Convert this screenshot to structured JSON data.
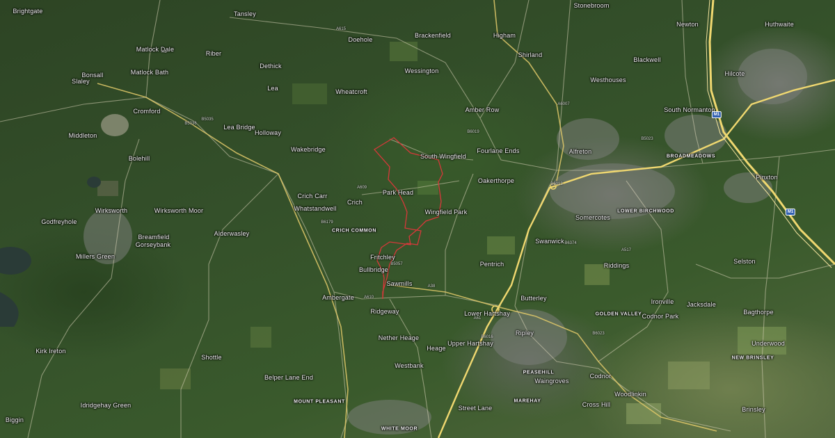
{
  "map": {
    "boundary_color": "#d8383a",
    "motorway_color": "#f0d870",
    "road_color": "#d9d3b8",
    "motorway_shield": "M1",
    "places": [
      "Brightgate",
      "Tansley",
      "Stonebroom",
      "Matlock Dale",
      "Doehole",
      "Brackenfield",
      "Higham",
      "Newton",
      "Huthwaite",
      "Bonsall",
      "Matlock Bath",
      "Riber",
      "Shirland",
      "Blackwell",
      "Dethick",
      "Wessington",
      "Hilcote",
      "Slaley",
      "Westhouses",
      "Lea",
      "Wheatcroft",
      "Cromford",
      "South Normanton",
      "Amber Row",
      "Middleton",
      "Lea Bridge",
      "Holloway",
      "Alfreton",
      "Wakebridge",
      "South Wingfield",
      "Fourlane Ends",
      "Bolehill",
      "Pinxton",
      "Crich Carr",
      "Park Head",
      "Oakerthorpe",
      "Crich",
      "Wirksworth",
      "Wirksworth Moor",
      "Whatstandwell",
      "Wingfield Park",
      "Somercotes",
      "Godfreyhole",
      "Alderwasley",
      "Breamfield",
      "Gorseybank",
      "Swanwick",
      "Millers Green",
      "Fritchley",
      "Riddings",
      "Selston",
      "Pentrich",
      "Bullbridge",
      "Sawmills",
      "Ambergate",
      "Butterley",
      "Ironville",
      "Jacksdale",
      "Codnor Park",
      "Bagthorpe",
      "Ridgeway",
      "Lower Hartshay",
      "Ripley",
      "Kirk Ireton",
      "Nether Heage",
      "Heage",
      "Upper Hartshay",
      "Underwood",
      "Shottle",
      "Westbank",
      "Waingroves",
      "Codnor",
      "Belper Lane End",
      "Woodlinkin",
      "Idridgehay Green",
      "Cross Hill",
      "Street Lane",
      "Brinsley",
      "Biggin"
    ],
    "areas": [
      "BROADMEADOWS",
      "CRICH COMMON",
      "LOWER BIRCHWOOD",
      "GOLDEN VALLEY",
      "NEW BRINSLEY",
      "MOUNT PLEASANT",
      "WHITE MOOR",
      "MAREHAY",
      "PEASEHILL"
    ],
    "road_refs": [
      "A615",
      "A6",
      "B5036",
      "B5035",
      "A610",
      "A38",
      "B6013",
      "B6016",
      "A61",
      "B6019",
      "A6007",
      "B5023",
      "A609",
      "B6179",
      "B6374",
      "A517",
      "B5057",
      "B6023"
    ]
  }
}
